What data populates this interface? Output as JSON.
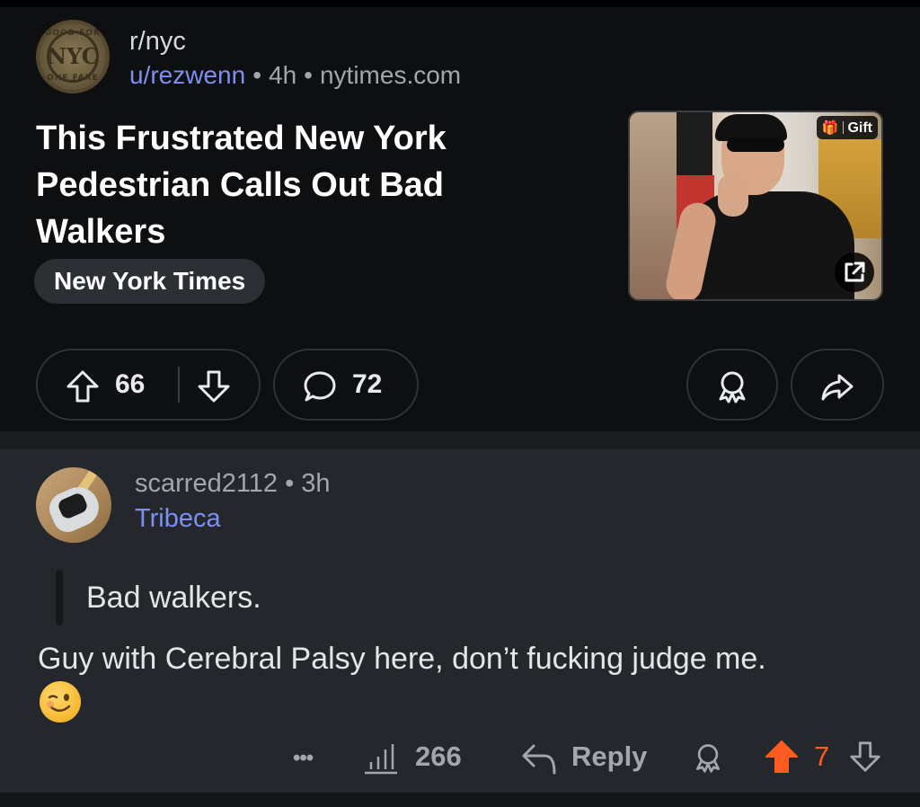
{
  "post": {
    "subreddit": "r/nyc",
    "subreddit_avatar": {
      "ring_top": "GOOD FOR",
      "ring_bottom": "ONE FARE",
      "monogram": "NYC"
    },
    "author": "u/rezwenn",
    "age": "4h",
    "domain": "nytimes.com",
    "separator": "•",
    "title": "This Frustrated New York Pedestrian Calls Out Bad Walkers",
    "flair": "New York Times",
    "thumbnail": {
      "gift_label": "Gift",
      "gift_icon": "gift-icon",
      "external_icon": "external-link-icon"
    },
    "actions": {
      "upvote_icon": "upvote-arrow-icon",
      "score": "66",
      "downvote_icon": "downvote-arrow-icon",
      "comment_icon": "speech-bubble-icon",
      "comments": "72",
      "award_icon": "award-icon",
      "share_icon": "share-arrow-icon"
    }
  },
  "comment": {
    "username": "scarred2112",
    "age": "3h",
    "separator": "•",
    "user_flair": "Tribeca",
    "quote": "Bad walkers.",
    "body": "Guy with Cerebral Palsy here, don’t fucking judge me.",
    "emoji": "winking-face",
    "actions": {
      "more": "•••",
      "stats_icon": "bar-chart-icon",
      "views": "266",
      "reply_icon": "reply-arrow-icon",
      "reply_label": "Reply",
      "award_icon": "award-icon",
      "upvote_icon": "upvote-arrow-filled-icon",
      "score": "7",
      "downvote_icon": "downvote-arrow-icon"
    }
  },
  "colors": {
    "background": "#0e0f11",
    "comment_background": "#24282c",
    "link_blue": "#7d8ff0",
    "upvote_orange": "#ff5a1f",
    "muted_text": "#a2a6ad"
  }
}
